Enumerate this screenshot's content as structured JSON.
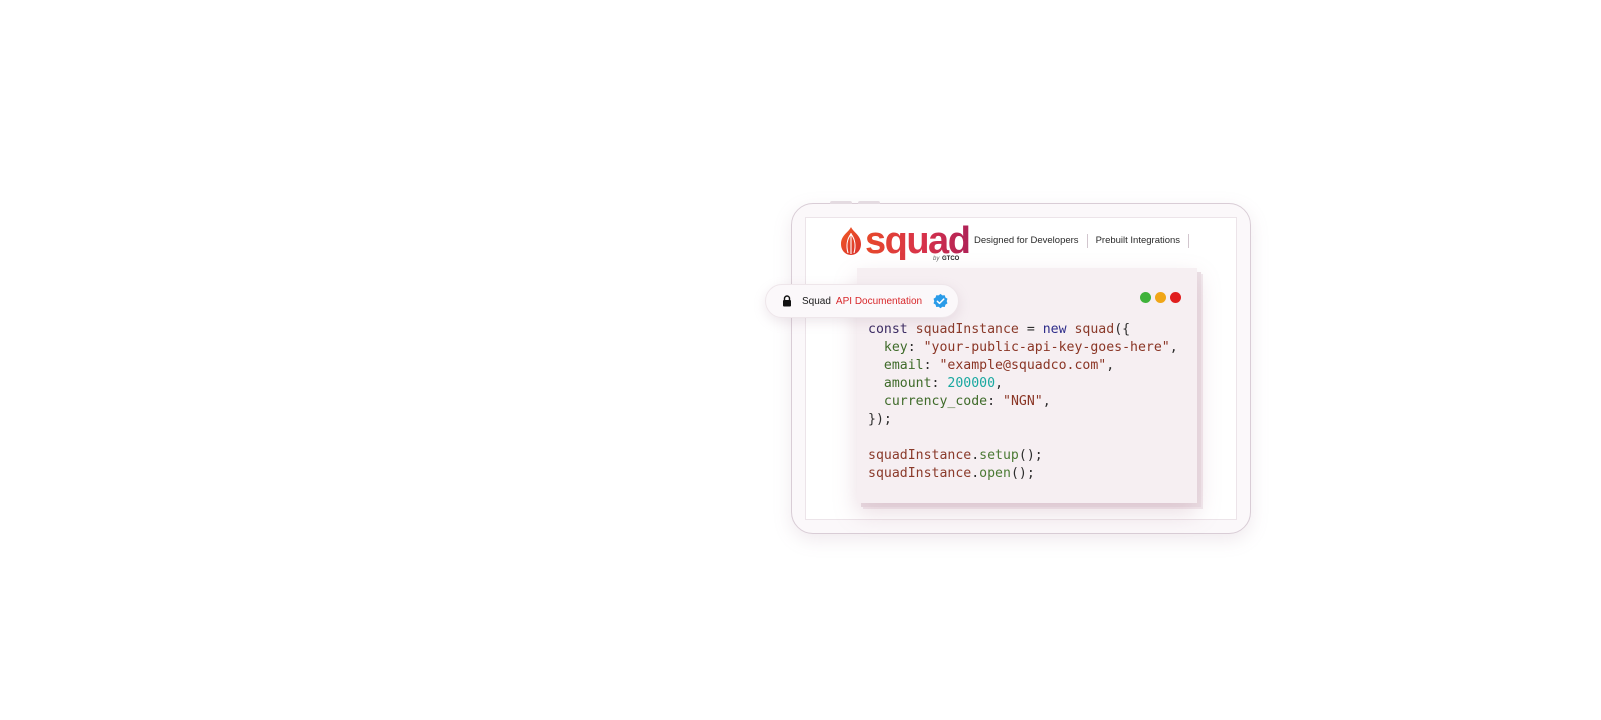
{
  "logo": {
    "wordmark": "squad",
    "sub_by": "by",
    "sub_company": "GTCO",
    "brand_gradient": [
      "#e7492a",
      "#d8324a",
      "#b02257"
    ]
  },
  "nav": {
    "items": [
      {
        "label": "Designed for Developers"
      },
      {
        "label": "Prebuilt Integrations"
      }
    ]
  },
  "badge": {
    "icon_left": "lock-icon",
    "brand": "Squad",
    "label": "API Documentation",
    "label_color": "#d8272a",
    "icon_right": "verified-icon",
    "verified_color": "#2a9be8"
  },
  "window_controls": {
    "colors": [
      "#3fb23a",
      "#f0a617",
      "#e01e1e"
    ]
  },
  "code": {
    "l1": {
      "t1": "const",
      "t2": " ",
      "t3": "squadInstance",
      "t4": " = ",
      "t5": "new",
      "t6": " ",
      "t7": "squad",
      "t8": "({"
    },
    "l2": {
      "t1": "  ",
      "t2": "key",
      "t3": ": ",
      "t4": "\"your-public-api-key-goes-here\"",
      "t5": ","
    },
    "l3": {
      "t1": "  ",
      "t2": "email",
      "t3": ": ",
      "t4": "\"example@squadco.com\"",
      "t5": ","
    },
    "l4": {
      "t1": "  ",
      "t2": "amount",
      "t3": ": ",
      "t4": "200000",
      "t5": ","
    },
    "l5": {
      "t1": "  ",
      "t2": "currency_code",
      "t3": ": ",
      "t4": "\"NGN\"",
      "t5": ","
    },
    "l6": {
      "t1": "});"
    },
    "l8": {
      "t1": "squadInstance",
      "t2": ".",
      "t3": "setup",
      "t4": "();"
    },
    "l9": {
      "t1": "squadInstance",
      "t2": ".",
      "t3": "open",
      "t4": "();"
    }
  }
}
